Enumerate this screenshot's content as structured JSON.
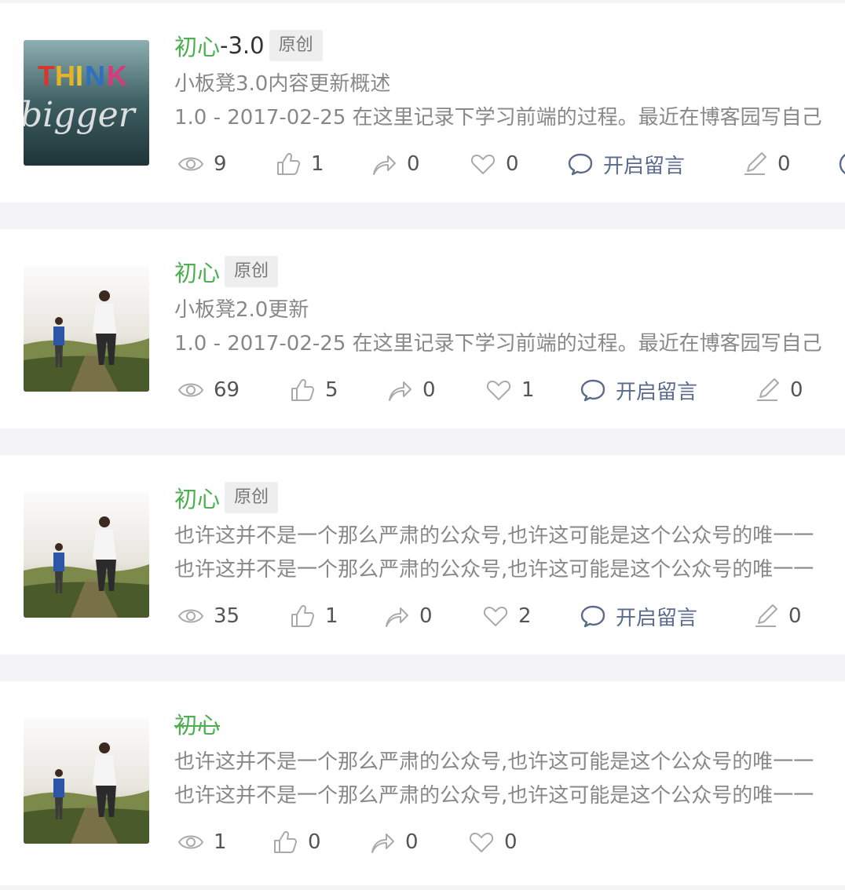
{
  "articles": [
    {
      "title_green": "初心",
      "title_rest": "-3.0",
      "tag": "原创",
      "lines": [
        "小板凳3.0内容更新概述",
        "1.0 - 2017-02-25 在这里记录下学习前端的过程。最近在博客园写自己"
      ],
      "stats": {
        "views": "9",
        "likes": "1",
        "shares": "0",
        "favorites": "0",
        "comment_label": "开启留言",
        "edits": "0"
      },
      "thumb": "think-bigger"
    },
    {
      "title_green": "初心",
      "title_rest": "",
      "tag": "原创",
      "lines": [
        "小板凳2.0更新",
        "1.0 - 2017-02-25 在这里记录下学习前端的过程。最近在博客园写自己"
      ],
      "stats": {
        "views": "69",
        "likes": "5",
        "shares": "0",
        "favorites": "1",
        "comment_label": "开启留言",
        "edits": "0"
      },
      "thumb": "father-son"
    },
    {
      "title_green": "初心",
      "title_rest": "",
      "tag": "原创",
      "lines": [
        "也许这并不是一个那么严肃的公众号,也许这可能是这个公众号的唯一一",
        "也许这并不是一个那么严肃的公众号,也许这可能是这个公众号的唯一一"
      ],
      "stats": {
        "views": "35",
        "likes": "1",
        "shares": "0",
        "favorites": "2",
        "comment_label": "开启留言",
        "edits": "0"
      },
      "thumb": "father-son"
    },
    {
      "title_green": "初心",
      "title_rest": "",
      "tag": "",
      "lines": [
        "也许这并不是一个那么严肃的公众号,也许这可能是这个公众号的唯一一",
        "也许这并不是一个那么严肃的公众号,也许这可能是这个公众号的唯一一"
      ],
      "stats": {
        "views": "1",
        "likes": "0",
        "shares": "0",
        "favorites": "0"
      },
      "thumb": "father-son"
    }
  ],
  "colors": {
    "accent_green": "#4caf50",
    "comment_blue": "#5a6b8c",
    "bg": "#f3f3f5"
  }
}
